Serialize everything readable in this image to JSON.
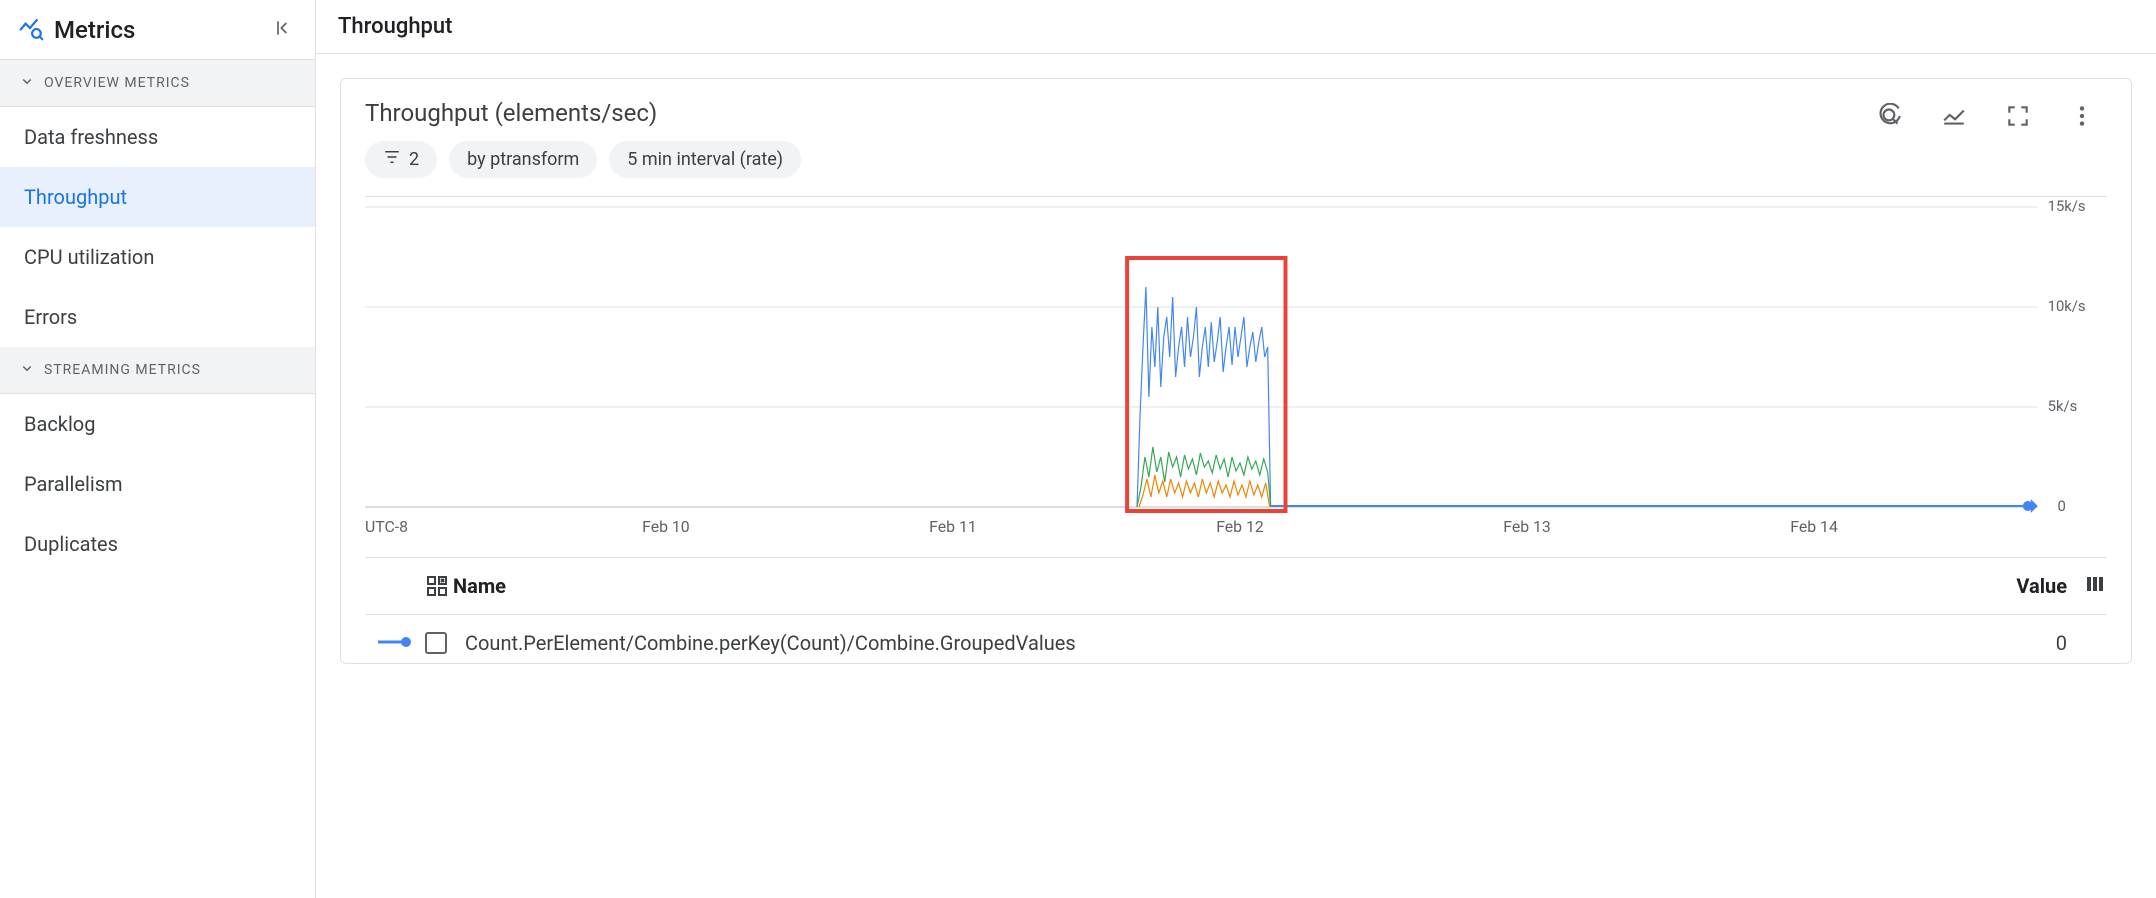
{
  "sidebar": {
    "title": "Metrics",
    "sections": [
      {
        "label": "OVERVIEW METRICS",
        "items": [
          {
            "label": "Data freshness",
            "active": false
          },
          {
            "label": "Throughput",
            "active": true
          },
          {
            "label": "CPU utilization",
            "active": false
          },
          {
            "label": "Errors",
            "active": false
          }
        ]
      },
      {
        "label": "STREAMING METRICS",
        "items": [
          {
            "label": "Backlog",
            "active": false
          },
          {
            "label": "Parallelism",
            "active": false
          },
          {
            "label": "Duplicates",
            "active": false
          }
        ]
      }
    ]
  },
  "header": {
    "title": "Throughput"
  },
  "card": {
    "title": "Throughput (elements/sec)",
    "chips": {
      "filter_count": "2",
      "group_by": "by ptransform",
      "interval": "5 min interval (rate)"
    },
    "actions": {
      "reset_zoom": "reset-zoom",
      "legend_toggle": "legend-toggle",
      "fullscreen": "fullscreen",
      "more": "more-options"
    }
  },
  "chart_data": {
    "type": "line",
    "xlabel": "UTC-8",
    "ylabel": "",
    "x_categories": [
      "Feb 10",
      "Feb 11",
      "Feb 12",
      "Feb 13",
      "Feb 14"
    ],
    "y_ticks": [
      {
        "value": 0,
        "label": "0"
      },
      {
        "value": 5000,
        "label": "5k/s"
      },
      {
        "value": 10000,
        "label": "10k/s"
      },
      {
        "value": 15000,
        "label": "15k/s"
      }
    ],
    "ylim": [
      0,
      15000
    ],
    "series": [
      {
        "name": "series-blue",
        "color": "#4285f4",
        "peak_approx": 11000
      },
      {
        "name": "series-green",
        "color": "#34a853",
        "peak_approx": 3500
      },
      {
        "name": "series-orange",
        "color": "#ea8600",
        "peak_approx": 2500
      }
    ],
    "active_region": {
      "start": "Feb 11 ~17:00",
      "end": "Feb 12 ~04:00",
      "note": "highlighted red box"
    },
    "baseline_nonzero_after": "Feb 12 ~04:00",
    "baseline_value_after": 0,
    "timezone": "UTC-8"
  },
  "table": {
    "headers": {
      "name": "Name",
      "value": "Value"
    },
    "rows": [
      {
        "swatch_color": "#4285f4",
        "name": "Count.PerElement/Combine.perKey(Count)/Combine.GroupedValues",
        "value": "0",
        "checked": false
      }
    ]
  }
}
